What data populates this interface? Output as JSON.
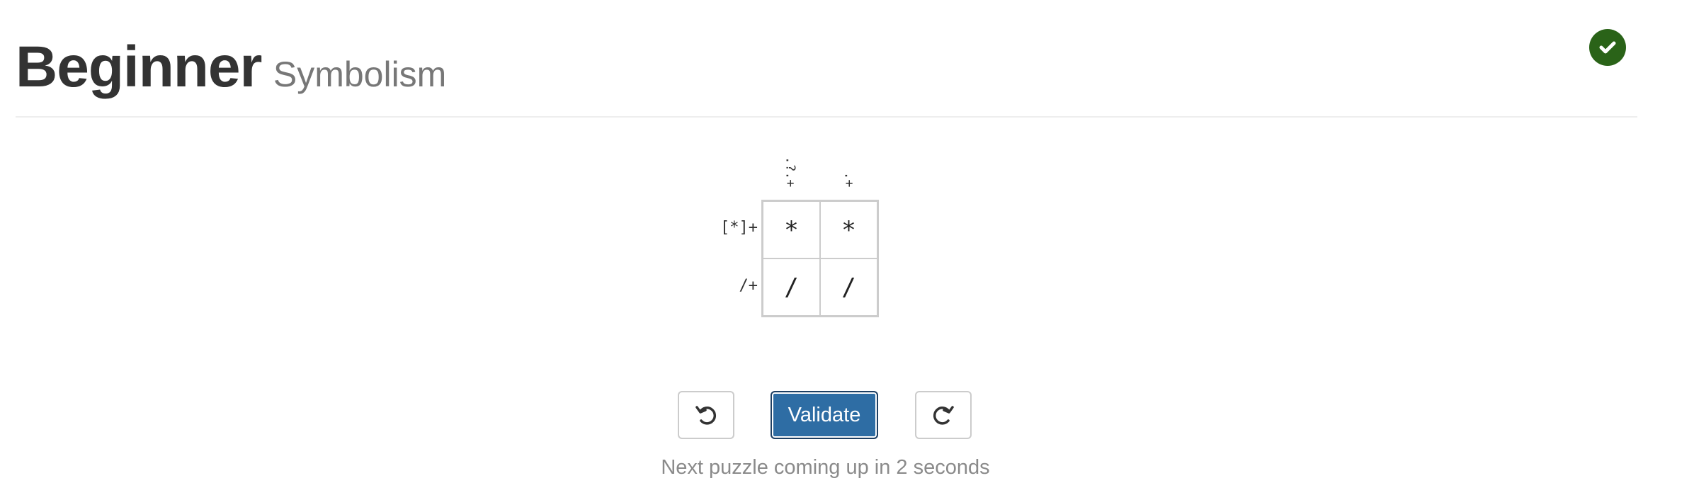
{
  "header": {
    "title": "Beginner",
    "subtitle": "Symbolism",
    "status_icon": "check-circle-icon",
    "status_color": "#2a6318"
  },
  "puzzle": {
    "column_clues": [
      ".?.+",
      ".+"
    ],
    "row_clues": [
      "[*]+",
      "/+"
    ],
    "grid": [
      [
        "*",
        "*"
      ],
      [
        "/",
        "/"
      ]
    ]
  },
  "controls": {
    "undo_icon": "undo-icon",
    "validate_label": "Validate",
    "redo_icon": "redo-icon",
    "accent_color": "#2e6da4"
  },
  "message": "Next puzzle coming up in 2 seconds"
}
